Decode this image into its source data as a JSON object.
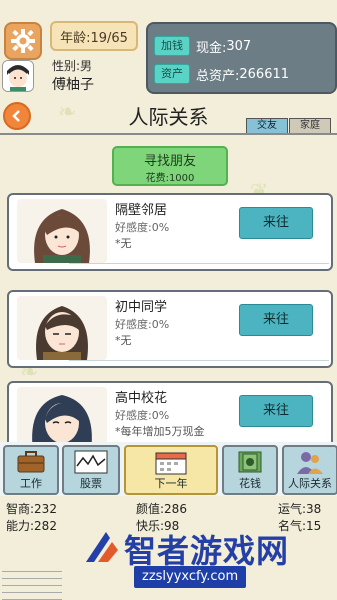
{
  "header": {
    "age_text": "年龄:19/65",
    "gender_text": "性别:男",
    "name": "傅柚子",
    "add_money_label": "加钱",
    "cash_label": "现金:",
    "cash_value": "307",
    "assets_label": "资产",
    "total_assets_label": "总资产:",
    "total_assets_value": "266611"
  },
  "page": {
    "title": "人际关系",
    "tabs": [
      {
        "label": "交友"
      },
      {
        "label": "家庭"
      }
    ]
  },
  "find_friends": {
    "label": "寻找朋友",
    "cost": "花费:1000"
  },
  "cards": [
    {
      "name": "隔壁邻居",
      "favor": "好感度:0%",
      "note": "*无",
      "button": "来往"
    },
    {
      "name": "初中同学",
      "favor": "好感度:0%",
      "note": "*无",
      "button": "来往"
    },
    {
      "name": "高中校花",
      "favor": "好感度:0%",
      "note": "*每年增加5万现金",
      "button": "来往"
    }
  ],
  "nav": [
    {
      "label": "工作"
    },
    {
      "label": "股票"
    },
    {
      "label": "下一年"
    },
    {
      "label": "花钱"
    },
    {
      "label": "人际关系"
    }
  ],
  "stats": {
    "iq": "智商:232",
    "looks": "颜值:286",
    "luck": "运气:38",
    "ability": "能力:282",
    "happiness": "快乐:98",
    "fame": "名气:15"
  },
  "watermark": {
    "text": "智者游戏网",
    "url": "zzslyyxcfy.com"
  },
  "colors": {
    "accent": "#4bb4c0",
    "panel": "#6d7d86",
    "green_button": "#7fd67a",
    "watermark": "#243fa6"
  }
}
